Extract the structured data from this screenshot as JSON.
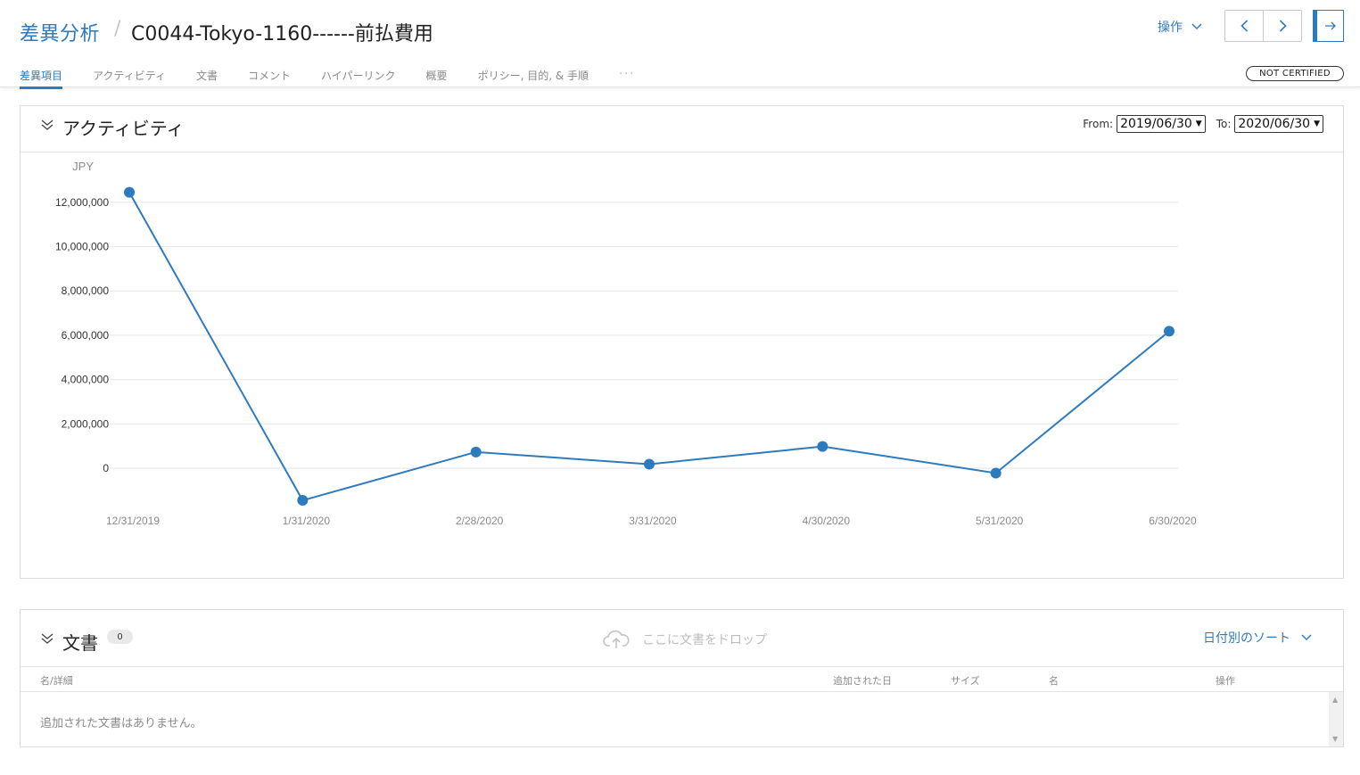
{
  "header": {
    "breadcrumb_root": "差異分析",
    "breadcrumb_separator": "/",
    "title": "C0044-Tokyo-1160------前払費用",
    "actions_label": "操作",
    "cert_badge": "NOT CERTIFIED"
  },
  "tabs": [
    {
      "label": "差異項目",
      "active": true
    },
    {
      "label": "アクティビティ",
      "active": false
    },
    {
      "label": "文書",
      "active": false
    },
    {
      "label": "コメント",
      "active": false
    },
    {
      "label": "ハイパーリンク",
      "active": false
    },
    {
      "label": "概要",
      "active": false
    },
    {
      "label": "ポリシー, 目的, & 手順",
      "active": false
    }
  ],
  "tabs_more": "···",
  "activity": {
    "title": "アクティビティ",
    "from_label": "From:",
    "from_value": "2019/06/30",
    "to_label": "To:",
    "to_value": "2020/06/30"
  },
  "chart_data": {
    "type": "line",
    "ylabel": "JPY",
    "ylim": [
      -1500000,
      12500000
    ],
    "yticks": [
      0,
      2000000,
      4000000,
      6000000,
      8000000,
      10000000,
      12000000
    ],
    "ytick_labels": [
      "0",
      "2,000,000",
      "4,000,000",
      "6,000,000",
      "8,000,000",
      "10,000,000",
      "12,000,000"
    ],
    "categories": [
      "12/31/2019",
      "1/31/2020",
      "2/28/2020",
      "3/31/2020",
      "4/30/2020",
      "5/31/2020",
      "6/30/2020"
    ],
    "series": [
      {
        "values": [
          12450000,
          -1450000,
          730000,
          180000,
          980000,
          -220000,
          6180000
        ]
      }
    ],
    "grid": true,
    "color": "#2d7bbf"
  },
  "documents": {
    "title": "文書",
    "count": "0",
    "drop_text": "ここに文書をドロップ",
    "sort_label": "日付別のソート",
    "columns": {
      "name_detail": "名/詳細",
      "added_date": "追加された日",
      "size": "サイズ",
      "name": "名",
      "actions": "操作"
    },
    "empty_message": "追加された文書はありません。"
  }
}
